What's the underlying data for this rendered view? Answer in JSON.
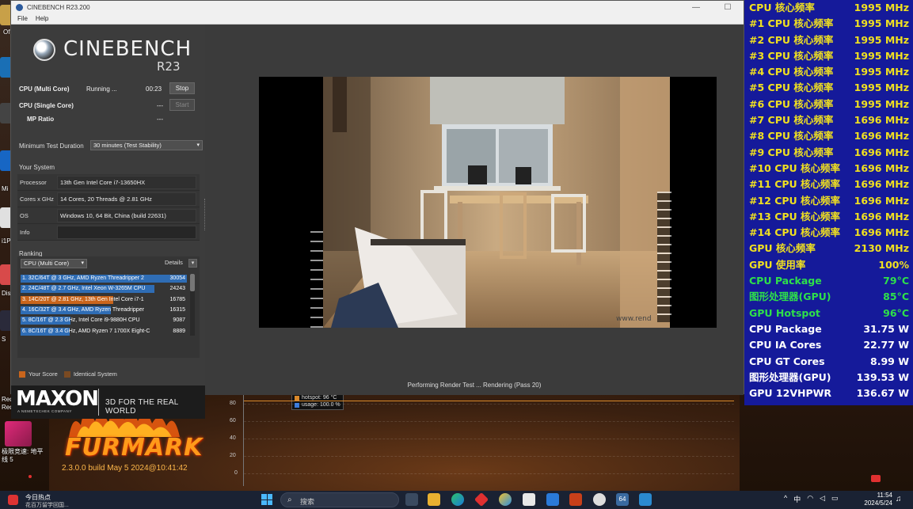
{
  "cinebench": {
    "window_title": "CINEBENCH R23.200",
    "menu": [
      "File",
      "Help"
    ],
    "logo_text": "CINEBENCH",
    "logo_version": "R23",
    "tests": [
      {
        "name": "CPU (Multi Core)",
        "status": "Running ...",
        "time": "00:23",
        "button": "Stop"
      },
      {
        "name": "CPU (Single Core)",
        "status": "",
        "time": "---",
        "button": "Start"
      },
      {
        "name": "MP Ratio",
        "status": "",
        "time": "---",
        "button": ""
      }
    ],
    "min_duration_label": "Minimum Test Duration",
    "min_duration_value": "30 minutes (Test Stability)",
    "your_system_title": "Your System",
    "system": [
      {
        "label": "Processor",
        "value": "13th Gen Intel Core i7-13650HX"
      },
      {
        "label": "Cores x GHz",
        "value": "14 Cores, 20 Threads @ 2.81 GHz"
      },
      {
        "label": "OS",
        "value": "Windows 10, 64 Bit, China (build 22631)"
      },
      {
        "label": "Info",
        "value": ""
      }
    ],
    "ranking_title": "Ranking",
    "ranking_select": "CPU (Multi Core)",
    "ranking_details": "Details",
    "ranking": [
      {
        "label": "1. 32C/64T @ 3 GHz, AMD Ryzen Threadripper 2",
        "score": "30054",
        "fraction": 1.0,
        "color": "#2f6db5"
      },
      {
        "label": "2. 24C/48T @ 2.7 GHz, Intel Xeon W-3265M CPU",
        "score": "24243",
        "fraction": 0.807,
        "color": "#2f6db5"
      },
      {
        "label": "3. 14C/20T @ 2.81 GHz, 13th Gen Intel Core i7-1",
        "score": "16785",
        "fraction": 0.558,
        "color": "#c9651c"
      },
      {
        "label": "4. 16C/32T @ 3.4 GHz, AMD Ryzen Threadripper",
        "score": "16315",
        "fraction": 0.543,
        "color": "#2f6db5"
      },
      {
        "label": "5. 8C/16T @ 2.3 GHz, Intel Core i9-9880H CPU",
        "score": "9087",
        "fraction": 0.302,
        "color": "#2f6db5"
      },
      {
        "label": "6. 8C/16T @ 3.4 GHz, AMD Ryzen 7 1700X Eight-C",
        "score": "8889",
        "fraction": 0.296,
        "color": "#2f6db5"
      }
    ],
    "legend": {
      "your_score": "Your Score",
      "identical": "Identical System",
      "your_color": "#c9651c",
      "identical_color": "#7a4a22"
    },
    "maxon_logo": "MAXON",
    "maxon_sub": "A NEMETSCHEK COMPANY",
    "maxon_tag": "3D FOR THE REAL WORLD",
    "render_status": "Performing Render Test ... Rendering (Pass 20)"
  },
  "furmark": {
    "logo": "FURMARK",
    "version": "2.3.0.0 build May  5 2024@10:41:42",
    "ticks": [
      "80",
      "60",
      "40",
      "20",
      "0"
    ],
    "legend": [
      "hotspot: 96 °C",
      "usage: 100.0 %"
    ]
  },
  "desktop_icons": [
    {
      "label": "Of"
    },
    {
      "label": "Mi"
    },
    {
      "label": "i1P"
    },
    {
      "label": "Dis"
    },
    {
      "label": "S"
    },
    {
      "label": "Red Dead Redempti..."
    },
    {
      "label": "极限竞速: 地平线 5"
    }
  ],
  "osd": [
    {
      "label": "CPU 核心频率",
      "value": "1995 MHz",
      "color": "#f0e020"
    },
    {
      "label": "#1 CPU 核心频率",
      "value": "1995 MHz",
      "color": "#f0e020"
    },
    {
      "label": "#2 CPU 核心频率",
      "value": "1995 MHz",
      "color": "#f0e020"
    },
    {
      "label": "#3 CPU 核心频率",
      "value": "1995 MHz",
      "color": "#f0e020"
    },
    {
      "label": "#4 CPU 核心频率",
      "value": "1995 MHz",
      "color": "#f0e020"
    },
    {
      "label": "#5 CPU 核心频率",
      "value": "1995 MHz",
      "color": "#f0e020"
    },
    {
      "label": "#6 CPU 核心频率",
      "value": "1995 MHz",
      "color": "#f0e020"
    },
    {
      "label": "#7 CPU 核心频率",
      "value": "1696 MHz",
      "color": "#f0e020"
    },
    {
      "label": "#8 CPU 核心频率",
      "value": "1696 MHz",
      "color": "#f0e020"
    },
    {
      "label": "#9 CPU 核心频率",
      "value": "1696 MHz",
      "color": "#f0e020"
    },
    {
      "label": "#10 CPU 核心频率",
      "value": "1696 MHz",
      "color": "#f0e020"
    },
    {
      "label": "#11 CPU 核心频率",
      "value": "1696 MHz",
      "color": "#f0e020"
    },
    {
      "label": "#12 CPU 核心频率",
      "value": "1696 MHz",
      "color": "#f0e020"
    },
    {
      "label": "#13 CPU 核心频率",
      "value": "1696 MHz",
      "color": "#f0e020"
    },
    {
      "label": "#14 CPU 核心频率",
      "value": "1696 MHz",
      "color": "#f0e020"
    },
    {
      "label": "GPU 核心频率",
      "value": "2130 MHz",
      "color": "#f0e020"
    },
    {
      "label": "GPU 使用率",
      "value": "100%",
      "color": "#f0e020"
    },
    {
      "label": "CPU Package",
      "value": "79°C",
      "color": "#2ee04a"
    },
    {
      "label": "图形处理器(GPU)",
      "value": "85°C",
      "color": "#2ee04a"
    },
    {
      "label": "GPU Hotspot",
      "value": "96°C",
      "color": "#2ee04a"
    },
    {
      "label": "CPU Package",
      "value": "31.75 W",
      "color": "#ffffff"
    },
    {
      "label": "CPU IA Cores",
      "value": "22.77 W",
      "color": "#ffffff"
    },
    {
      "label": "CPU GT Cores",
      "value": "8.99 W",
      "color": "#ffffff"
    },
    {
      "label": "图形处理器(GPU)",
      "value": "139.53 W",
      "color": "#ffffff"
    },
    {
      "label": "GPU 12VHPWR",
      "value": "136.67 W",
      "color": "#ffffff"
    }
  ],
  "taskbar": {
    "news_title": "今日热点",
    "news_sub": "花百万留学回国...",
    "search_placeholder": "搜索",
    "tray_ime": "中",
    "time": "11:54",
    "date": "2024/5/24"
  }
}
